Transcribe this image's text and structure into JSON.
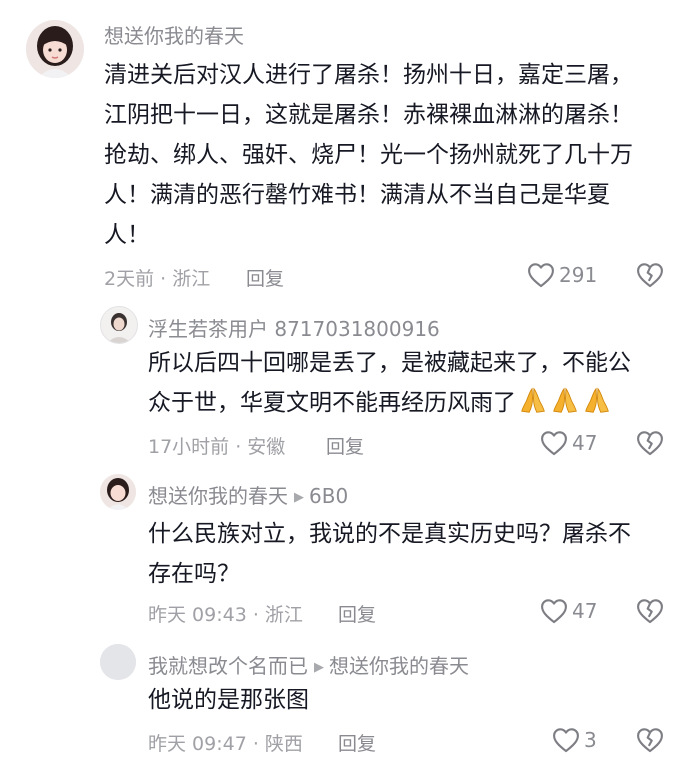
{
  "comments": [
    {
      "user": "想送你我的春天",
      "text_lines": [
        "清进关后对汉人进行了屠杀！扬州十日，嘉定三屠，",
        "江阴把十一日，这就是屠杀！赤裸裸血淋淋的屠杀！",
        "抢劫、绑人、强奸、烧尸！光一个扬州就死了几十万",
        "人！满清的恶行罄竹难书！满清从不当自己是华夏",
        "人！"
      ],
      "meta": "2天前 · 浙江",
      "reply_label": "回复",
      "likes": "291"
    },
    {
      "user": "浮生若茶用户 8717031800916",
      "text_lines": [
        "所以后四十回哪是丢了，是被藏起来了，不能公",
        "众于世，华夏文明不能再经历风雨了"
      ],
      "emoji": [
        "folded-hands",
        "folded-hands",
        "folded-hands"
      ],
      "meta": "17小时前 · 安徽",
      "reply_label": "回复",
      "likes": "47"
    },
    {
      "user": "想送你我的春天",
      "reply_to": "6B0",
      "text_lines": [
        "什么民族对立，我说的不是真实历史吗？屠杀不",
        "存在吗？"
      ],
      "meta": "昨天 09:43 · 浙江",
      "reply_label": "回复",
      "likes": "47"
    },
    {
      "user": "我就想改个名而已",
      "reply_to": "想送你我的春天",
      "text_lines": [
        "他说的是那张图"
      ],
      "meta": "昨天 09:47 · 陕西",
      "reply_label": "回复",
      "likes": "3"
    }
  ],
  "colors": {
    "text": "#161823",
    "username": "#8a8b91",
    "meta": "#a0a1a6",
    "emoji": "#f5b02e"
  }
}
